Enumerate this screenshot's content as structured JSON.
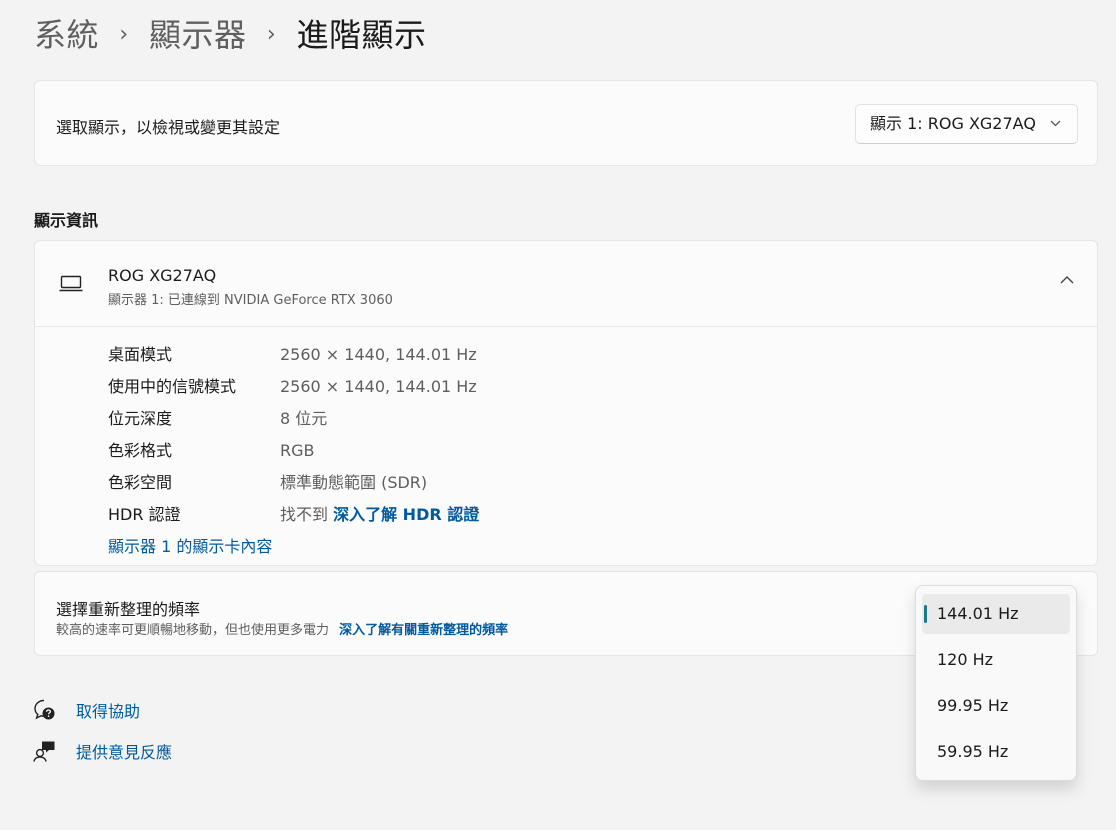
{
  "breadcrumb": {
    "items": [
      "系統",
      "顯示器",
      "進階顯示"
    ],
    "separator": "›"
  },
  "select_display": {
    "label": "選取顯示，以檢視或變更其設定",
    "dropdown_value": "顯示 1: ROG XG27AQ"
  },
  "display_info": {
    "section_title": "顯示資訊",
    "monitor_name": "ROG XG27AQ",
    "monitor_subtitle": "顯示器 1: 已連線到 NVIDIA GeForce RTX 3060",
    "rows": [
      {
        "label": "桌面模式",
        "value": "2560 × 1440, 144.01 Hz"
      },
      {
        "label": "使用中的信號模式",
        "value": "2560 × 1440, 144.01 Hz"
      },
      {
        "label": "位元深度",
        "value": "8 位元"
      },
      {
        "label": "色彩格式",
        "value": "RGB"
      },
      {
        "label": "色彩空間",
        "value": "標準動態範圍 (SDR)"
      }
    ],
    "hdr": {
      "label": "HDR 認證",
      "value": "找不到",
      "link": "深入了解 HDR 認證"
    },
    "adapter_link": "顯示器 1 的顯示卡內容"
  },
  "refresh_rate": {
    "title": "選擇重新整理的頻率",
    "subtitle": "較高的速率可更順暢地移動，但也使用更多電力",
    "link": "深入了解有關重新整理的頻率",
    "options": [
      "144.01 Hz",
      "120 Hz",
      "99.95 Hz",
      "59.95 Hz"
    ],
    "selected_index": 0
  },
  "footer": {
    "help": "取得協助",
    "feedback": "提供意見反應"
  },
  "colors": {
    "accent": "#1b7a8c",
    "link": "#005a9e",
    "background": "#f3f3f3",
    "card": "#fbfbfb"
  },
  "icons": {
    "monitor": "monitor-icon",
    "help": "help-icon",
    "feedback": "feedback-icon",
    "chevron_down": "chevron-down-icon",
    "chevron_up": "chevron-up-icon"
  }
}
